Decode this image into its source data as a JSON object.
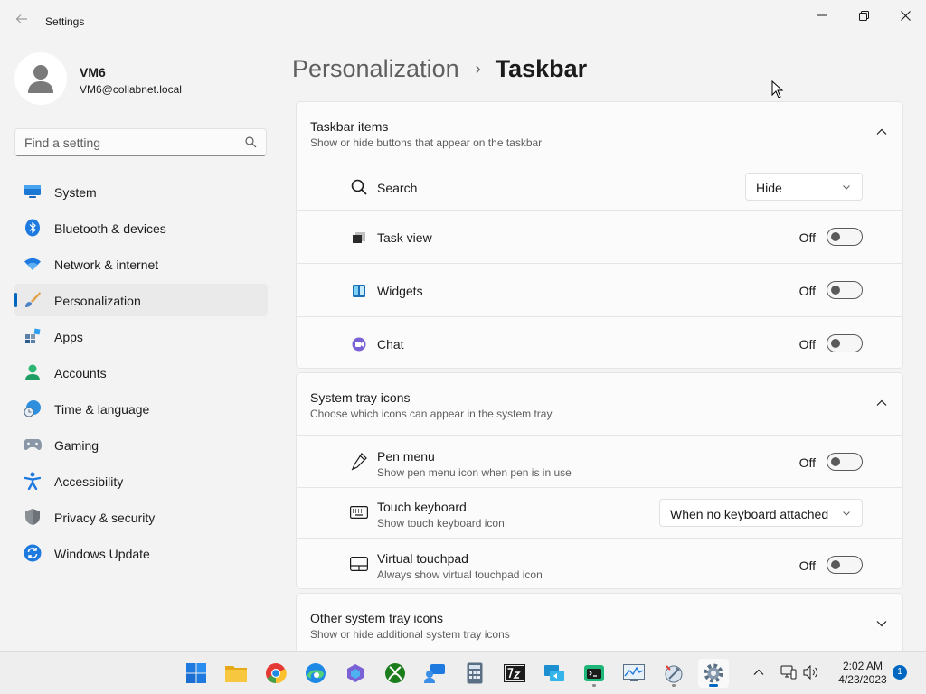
{
  "window": {
    "title": "Settings",
    "controls": [
      "minimize-icon",
      "maximize-icon",
      "close-icon"
    ]
  },
  "profile": {
    "name": "VM6",
    "email": "VM6@collabnet.local"
  },
  "search": {
    "placeholder": "Find a setting"
  },
  "sidebar": {
    "items": [
      {
        "label": "System",
        "icon": "system-icon"
      },
      {
        "label": "Bluetooth & devices",
        "icon": "bluetooth-icon"
      },
      {
        "label": "Network & internet",
        "icon": "wifi-icon"
      },
      {
        "label": "Personalization",
        "icon": "brush-icon",
        "selected": true
      },
      {
        "label": "Apps",
        "icon": "apps-icon"
      },
      {
        "label": "Accounts",
        "icon": "accounts-icon"
      },
      {
        "label": "Time & language",
        "icon": "globe-clock-icon"
      },
      {
        "label": "Gaming",
        "icon": "gamepad-icon"
      },
      {
        "label": "Accessibility",
        "icon": "accessibility-icon"
      },
      {
        "label": "Privacy & security",
        "icon": "shield-icon"
      },
      {
        "label": "Windows Update",
        "icon": "update-icon"
      }
    ]
  },
  "breadcrumb": {
    "parent": "Personalization",
    "separator": "›",
    "current": "Taskbar"
  },
  "taskbar_items": {
    "title": "Taskbar items",
    "subtitle": "Show or hide buttons that appear on the taskbar",
    "search": {
      "label": "Search",
      "value": "Hide"
    },
    "task_view": {
      "label": "Task view",
      "state": "Off"
    },
    "widgets": {
      "label": "Widgets",
      "state": "Off"
    },
    "chat": {
      "label": "Chat",
      "state": "Off"
    }
  },
  "system_tray": {
    "title": "System tray icons",
    "subtitle": "Choose which icons can appear in the system tray",
    "pen_menu": {
      "label": "Pen menu",
      "desc": "Show pen menu icon when pen is in use",
      "state": "Off"
    },
    "touch_keyboard": {
      "label": "Touch keyboard",
      "desc": "Show touch keyboard icon",
      "value": "When no keyboard attached"
    },
    "virtual_touchpad": {
      "label": "Virtual touchpad",
      "desc": "Always show virtual touchpad icon",
      "state": "Off"
    }
  },
  "other_tray": {
    "title": "Other system tray icons",
    "subtitle": "Show or hide additional system tray icons"
  },
  "os_taskbar": {
    "apps": [
      "start-icon",
      "file-explorer-icon",
      "chrome-icon",
      "edge-icon",
      "copilot-icon",
      "xbox-icon",
      "people-icon",
      "calculator-icon",
      "7zip-icon",
      "remote-desktop-icon",
      "terminal-icon",
      "performance-monitor-icon",
      "tools-icon",
      "settings-icon"
    ],
    "time": "2:02 AM",
    "date": "4/23/2023",
    "notification_count": "1"
  },
  "colors": {
    "accent": "#0067c0",
    "background": "#f3f3f3",
    "card": "#fbfbfb"
  }
}
